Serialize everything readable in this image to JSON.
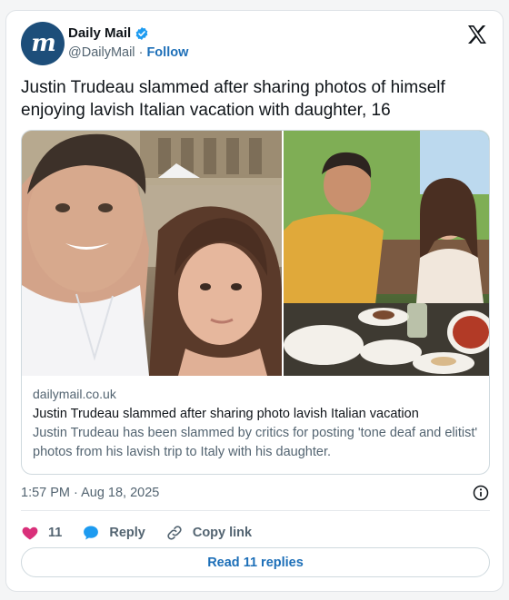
{
  "author": {
    "display_name": "Daily Mail",
    "handle": "@DailyMail",
    "separator": "·",
    "follow_label": "Follow",
    "avatar_letters": "m"
  },
  "tweet": {
    "text": "Justin Trudeau slammed after sharing photos of himself enjoying lavish Italian vacation with daughter, 16",
    "timestamp": "1:57 PM · Aug 18, 2025"
  },
  "link_card": {
    "domain": "dailymail.co.uk",
    "title": "Justin Trudeau slammed after sharing photo lavish Italian vacation",
    "description": "Justin Trudeau has been slammed by critics for posting 'tone deaf and elitist' photos from his lavish trip to Italy with his daughter."
  },
  "actions": {
    "like_count": "11",
    "reply_label": "Reply",
    "copy_link_label": "Copy link"
  },
  "read_replies_label": "Read 11 replies",
  "icons": {
    "verified": "verified-badge-icon",
    "x_logo": "x-logo-icon",
    "info": "info-icon",
    "heart": "heart-icon",
    "reply": "speech-bubble-icon",
    "link": "link-icon"
  },
  "colors": {
    "accent": "#1d6fb8",
    "heart": "#d9307a",
    "reply_bubble": "#1d9bf0",
    "avatar_bg": "#1d4e7a"
  }
}
